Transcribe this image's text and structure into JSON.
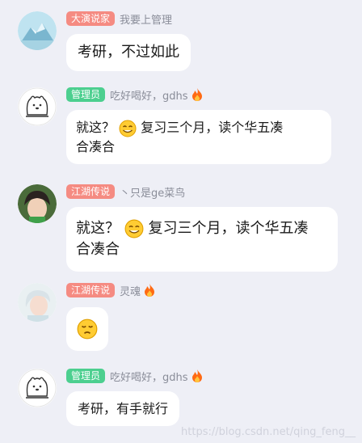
{
  "messages": [
    {
      "badge": "大演说家",
      "name": "我要上管理",
      "text": "考研，不过如此"
    },
    {
      "badge": "管理员",
      "name": "吃好喝好，gdhs",
      "text_a": "就这？",
      "text_b": "复习三个月，读个华五凑",
      "text_c": "合凑合"
    },
    {
      "badge": "江湖传说",
      "name": "丶只是ge菜鸟",
      "text_a": "就这？",
      "text_b": "复习三个月，读个华五凑",
      "text_c": "合凑合"
    },
    {
      "badge": "江湖传说",
      "name": "灵魂"
    },
    {
      "badge": "管理员",
      "name": "吃好喝好，gdhs",
      "text": "考研，有手就行"
    }
  ],
  "colors": {
    "badge_orange": "#f58b82",
    "badge_green": "#4ccf8f",
    "background": "#eeeff6"
  },
  "icons": [
    "fire-icon",
    "smile-emoji",
    "frown-emoji"
  ],
  "watermark": "https://blog.csdn.net/qing_feng__"
}
